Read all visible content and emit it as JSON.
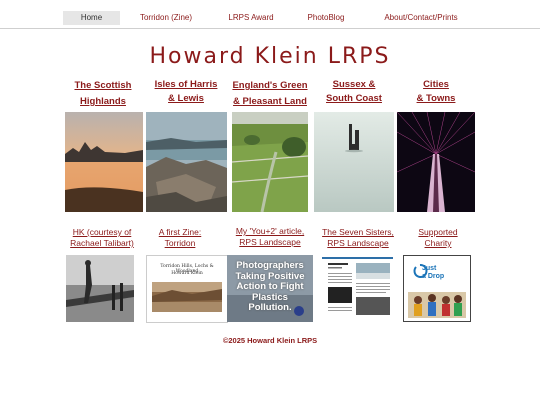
{
  "nav": {
    "items": [
      "Home",
      "Torridon (Zine)",
      "LRPS Award",
      "PhotoBlog",
      "About/Contact/Prints"
    ]
  },
  "site_title": "Howard Klein LRPS",
  "categories": [
    {
      "line1": "The Scottish",
      "line2": "Highlands"
    },
    {
      "line1": "Isles of Harris",
      "line2": "& Lewis"
    },
    {
      "line1": "England's Green",
      "line2": "& Pleasant Land"
    },
    {
      "line1": "Sussex &",
      "line2": "South Coast"
    },
    {
      "line1": "Cities",
      "line2": "& Towns"
    }
  ],
  "features": [
    {
      "line1": "HK  (courtesy of",
      "line2": "Rachael Talibart)"
    },
    {
      "line1": "A first Zine:",
      "line2": "Torridon"
    },
    {
      "line1": "My 'You+2' article,",
      "line2": "RPS Landscape"
    },
    {
      "line1": "The Seven Sisters,",
      "line2": "RPS Landscape"
    },
    {
      "line1": "Supported",
      "line2": "Charity"
    }
  ],
  "zine_cover": {
    "line1": "Torridon Hills, Lochs & Woodland",
    "line2": "Howard Klein"
  },
  "plastics_cover": {
    "text": "Photographers Taking Positive Action to Fight Plastics Pollution."
  },
  "charity_logo": {
    "line1": "Just",
    "line2": "a Drop"
  },
  "footer": "©2025 Howard Klein LRPS",
  "colors": {
    "accent": "#8b1a1a",
    "nav_active_bg": "#e6e6e6"
  }
}
